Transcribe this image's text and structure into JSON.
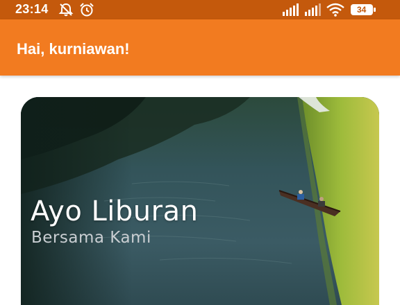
{
  "status_bar": {
    "time": "23:14",
    "icons": [
      "muted-bell-icon",
      "alarm-icon",
      "signal-icon",
      "signal-icon",
      "wifi-icon",
      "battery-icon"
    ],
    "battery": "34",
    "color": "#c4590c"
  },
  "app_bar": {
    "greeting": "Hai, kurniawan!",
    "color": "#f27b20"
  },
  "hero": {
    "title": "Ayo Liburan",
    "subtitle": "Bersama Kami"
  }
}
